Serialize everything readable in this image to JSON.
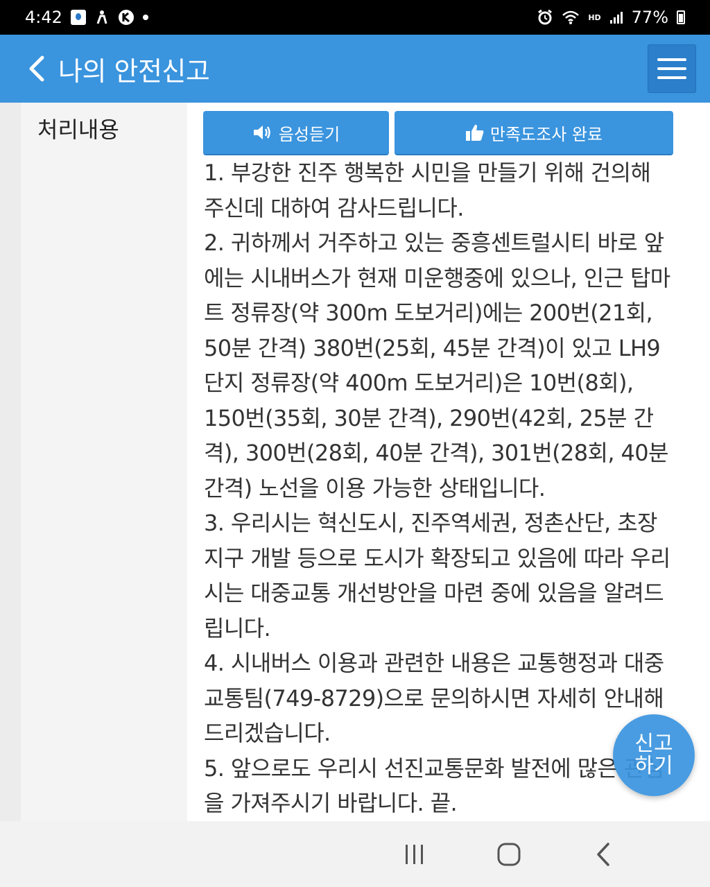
{
  "status_bar": {
    "time": "4:42",
    "battery": "77%",
    "hd_label": "HD"
  },
  "header": {
    "title": "나의 안전신고"
  },
  "section": {
    "label": "처리내용"
  },
  "buttons": {
    "voice_label": "음성듣기",
    "survey_label": "만족도조사 완료"
  },
  "content": {
    "paragraphs": [
      "1. 부강한 진주 행복한 시민을 만들기 위해 건의해 주신데 대하여 감사드립니다.",
      "2. 귀하께서 거주하고 있는 중흥센트럴시티 바로 앞에는 시내버스가 현재 미운행중에 있으나, 인근 탑마트 정류장(약 300m 도보거리)에는 200번(21회, 50분 간격) 380번(25회, 45분 간격)이 있고 LH9단지 정류장(약 400m 도보거리)은 10번(8회), 150번(35회, 30분 간격), 290번(42회, 25분 간격), 300번(28회, 40분 간격), 301번(28회, 40분 간격) 노선을 이용 가능한 상태입니다.",
      "3. 우리시는 혁신도시, 진주역세권, 정촌산단, 초장지구 개발 등으로 도시가 확장되고 있음에 따라 우리시는 대중교통 개선방안을 마련 중에 있음을 알려드립니다.",
      "4. 시내버스 이용과 관련한 내용은 교통행정과 대중교통팀(749-8729)으로 문의하시면 자세히 안내해 드리겠습니다.",
      "5. 앞으로도 우리시 선진교통문화 발전에 많은 관심을 가져주시기 바랍니다. 끝."
    ]
  },
  "fab": {
    "line1": "신고",
    "line2": "하기"
  },
  "colors": {
    "primary": "#3a94de",
    "status_bar": "#000000",
    "nav_bar": "#f2f2f2"
  },
  "icons": [
    "back-arrow-icon",
    "menu-icon",
    "speaker-icon",
    "thumbs-up-icon",
    "recent-apps-icon",
    "home-icon",
    "back-nav-icon"
  ]
}
